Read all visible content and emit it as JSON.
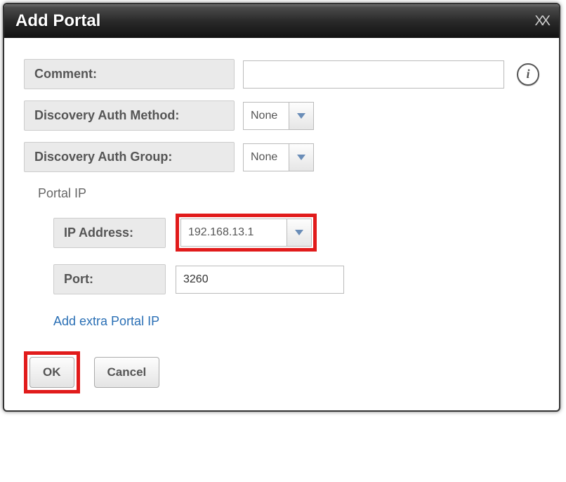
{
  "dialog": {
    "title": "Add Portal"
  },
  "fields": {
    "comment_label": "Comment:",
    "comment_value": "",
    "dam_label": "Discovery Auth Method:",
    "dam_value": "None",
    "dag_label": "Discovery Auth Group:",
    "dag_value": "None"
  },
  "portal": {
    "section_title": "Portal IP",
    "ip_label": "IP Address:",
    "ip_value": "192.168.13.1",
    "port_label": "Port:",
    "port_value": "3260",
    "add_extra_link": "Add extra Portal IP"
  },
  "buttons": {
    "ok": "OK",
    "cancel": "Cancel"
  },
  "info_glyph": "i",
  "close_glyph": "XX"
}
